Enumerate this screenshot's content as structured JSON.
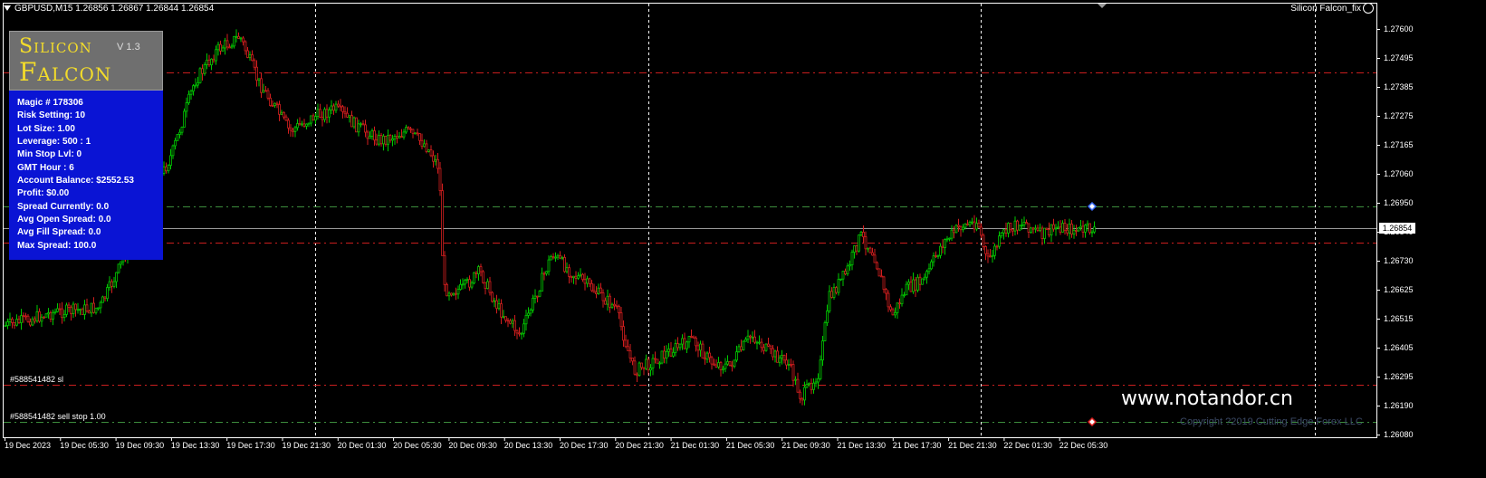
{
  "chart": {
    "symbol_line": "GBPUSD,M15  1.26856 1.26867 1.26844 1.26854",
    "ea_name": "Silicon Falcon_fix",
    "current_price": "1.26854",
    "price_ticks": [
      "1.27600",
      "1.27495",
      "1.27385",
      "1.27275",
      "1.27165",
      "1.27060",
      "1.26950",
      "1.26840",
      "1.26730",
      "1.26625",
      "1.26515",
      "1.26405",
      "1.26295",
      "1.26190",
      "1.26080"
    ],
    "time_ticks": [
      "19 Dec 2023",
      "19 Dec 05:30",
      "19 Dec 09:30",
      "19 Dec 13:30",
      "19 Dec 17:30",
      "19 Dec 21:30",
      "20 Dec 01:30",
      "20 Dec 05:30",
      "20 Dec 09:30",
      "20 Dec 13:30",
      "20 Dec 17:30",
      "20 Dec 21:30",
      "21 Dec 01:30",
      "21 Dec 05:30",
      "21 Dec 09:30",
      "21 Dec 13:30",
      "21 Dec 17:30",
      "21 Dec 21:30",
      "22 Dec 01:30",
      "22 Dec 05:30"
    ],
    "colors": {
      "background": "#000000",
      "bull": "#00c800",
      "bear": "#d21e1e",
      "red_level": "#c81e1e",
      "green_level": "#3c8c3c",
      "grid": "#ffffff"
    }
  },
  "panel": {
    "title_line1": "Silicon",
    "title_line2": "Falcon",
    "version": "V 1.3",
    "rows": [
      "Magic # 178306",
      "Risk Setting: 10",
      "Lot Size: 1.00",
      "Leverage: 500 : 1",
      "Min Stop Lvl: 0",
      "GMT Hour : 6",
      "Account Balance: $2552.53",
      "Profit: $0.00",
      "Spread Currently:  0.0",
      "Avg Open Spread:  0.0",
      "Avg Fill Spread:       0.0",
      "Max Spread:        100.0"
    ]
  },
  "trades": {
    "sl_label": "#588541482 sl",
    "order_label": "#588541482 sell stop 1.00"
  },
  "watermark": "www.notandor.cn",
  "copyright": "Copyright ?2019 Cutting Edge Forex LLC"
}
